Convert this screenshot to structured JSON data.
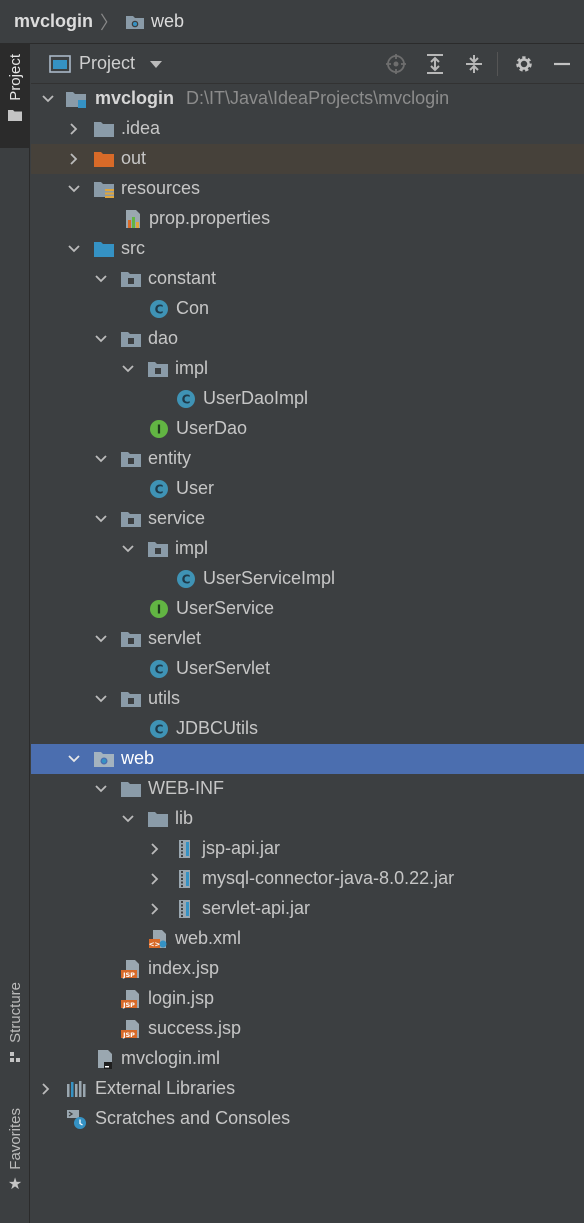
{
  "navbar": {
    "project": "mvclogin",
    "folder": "web"
  },
  "sidebar": {
    "project_tab": "Project",
    "structure_tab": "Structure",
    "favorites_tab": "Favorites"
  },
  "panel": {
    "title": "Project"
  },
  "tree": {
    "root_name": "mvclogin",
    "root_path": "D:\\IT\\Java\\IdeaProjects\\mvclogin",
    "items": [
      "mvclogin",
      ".idea",
      "out",
      "resources",
      "prop.properties",
      "src",
      "constant",
      "Con",
      "dao",
      "impl",
      "UserDaoImpl",
      "UserDao",
      "entity",
      "User",
      "service",
      "impl",
      "UserServiceImpl",
      "UserService",
      "servlet",
      "UserServlet",
      "utils",
      "JDBCUtils",
      "web",
      "WEB-INF",
      "lib",
      "jsp-api.jar",
      "mysql-connector-java-8.0.22.jar",
      "servlet-api.jar",
      "web.xml",
      "index.jsp",
      "login.jsp",
      "success.jsp",
      "mvclogin.iml",
      "External Libraries",
      "Scratches and Consoles"
    ]
  },
  "colors": {
    "folder_gray": "#8a9ba8",
    "folder_blue": "#3592c4",
    "folder_orange": "#d86a28",
    "class_icon": "#3f93b5",
    "interface_icon": "#62b543",
    "selection": "#4b6eaf"
  }
}
